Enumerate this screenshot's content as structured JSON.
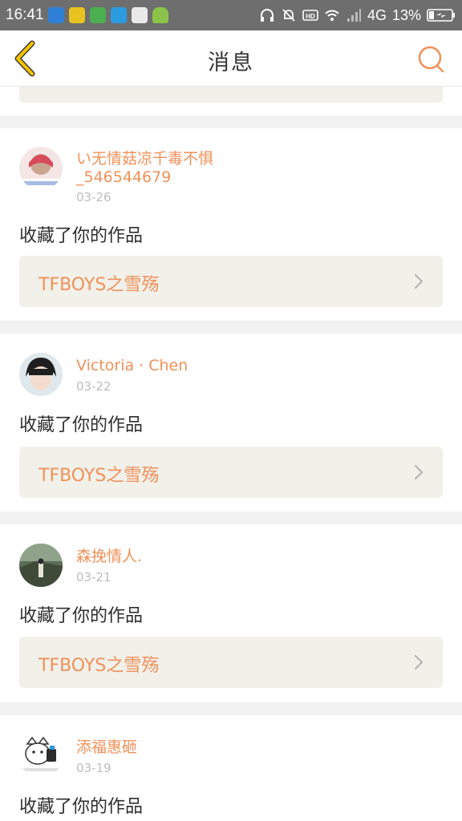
{
  "status_bar": {
    "time": "16:41",
    "network": "4G",
    "battery": "13%",
    "left_icons": [
      "app-icon-1",
      "app-icon-2",
      "app-icon-3",
      "app-icon-4",
      "app-icon-5",
      "android-icon"
    ],
    "right_icons": [
      "headphones-icon",
      "mute-icon",
      "hd-icon",
      "wifi-icon",
      "signal-icon",
      "battery-icon"
    ]
  },
  "navbar": {
    "title": "消息",
    "back_icon": "chevron-left-icon",
    "search_icon": "search-icon"
  },
  "colors": {
    "accent": "#f0915a",
    "back_arrow": "#f5c400",
    "work_bg": "#f1f0e9",
    "page_bg": "#f2f2f2"
  },
  "messages": [
    {
      "username": "い无情菇凉千毒不惧_546544679",
      "date": "03-26",
      "action": "收藏了你的作品",
      "work_title": "TFBOYS之雪殇"
    },
    {
      "username": "Victoria · Chen",
      "date": "03-22",
      "action": "收藏了你的作品",
      "work_title": "TFBOYS之雪殇"
    },
    {
      "username": "森挽情人.",
      "date": "03-21",
      "action": "收藏了你的作品",
      "work_title": "TFBOYS之雪殇"
    },
    {
      "username": "添福惠砸",
      "date": "03-19",
      "action": "收藏了你的作品"
    }
  ]
}
